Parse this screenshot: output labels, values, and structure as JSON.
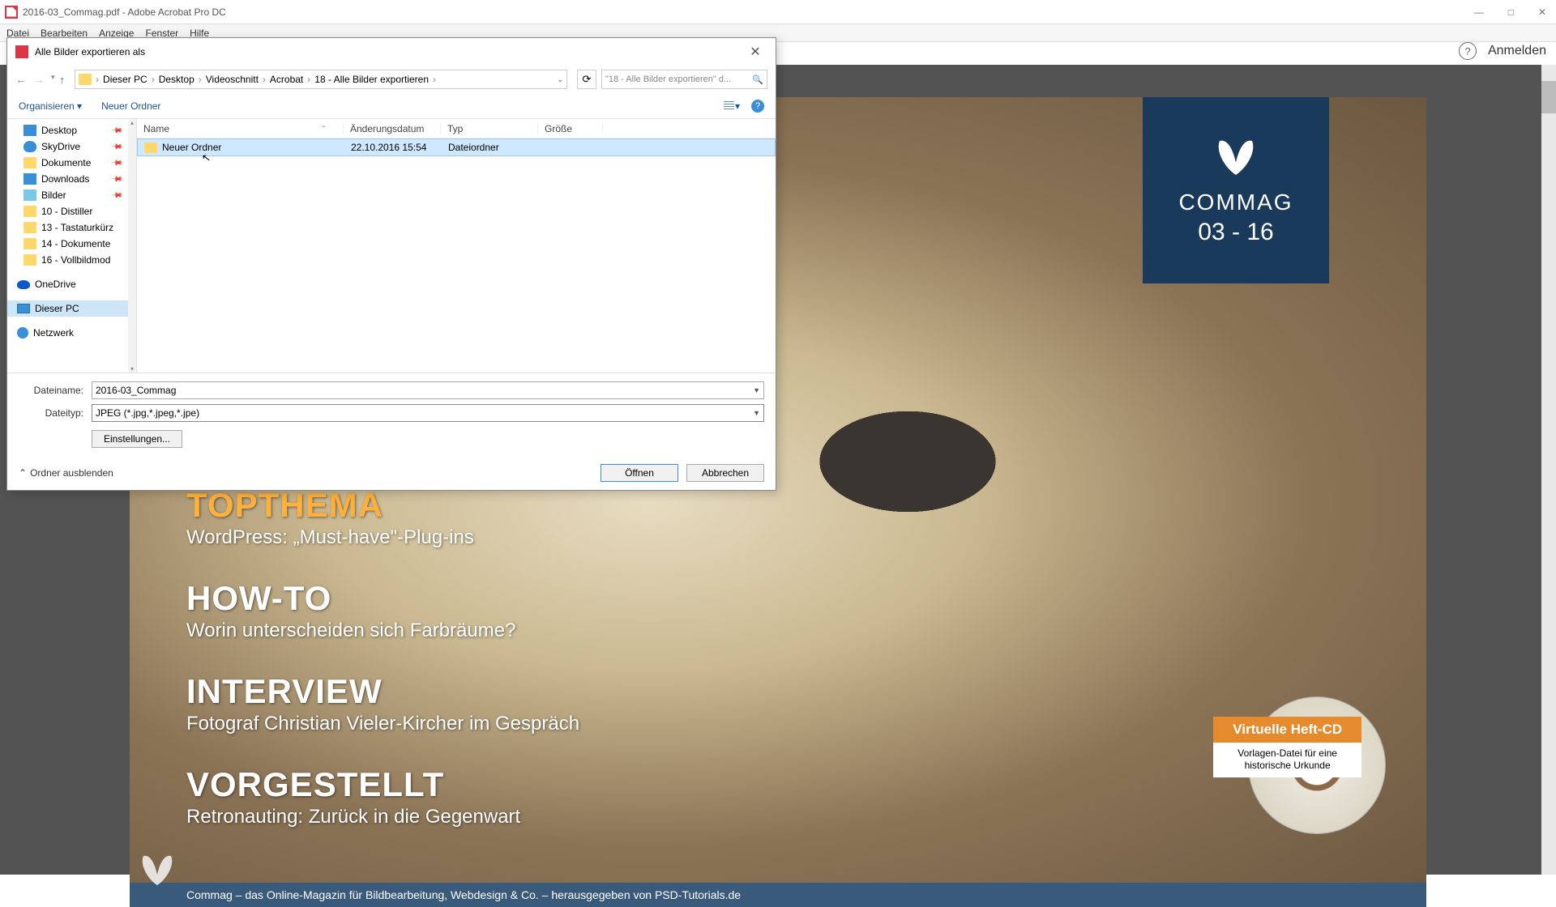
{
  "app": {
    "title": "2016-03_Commag.pdf - Adobe Acrobat Pro DC",
    "menu": [
      "Datei",
      "Bearbeiten",
      "Anzeige",
      "Fenster",
      "Hilfe"
    ],
    "login": "Anmelden"
  },
  "dialog": {
    "title": "Alle Bilder exportieren als",
    "breadcrumb": [
      "Dieser PC",
      "Desktop",
      "Videoschnitt",
      "Acrobat",
      "18 - Alle Bilder exportieren"
    ],
    "search_placeholder": "\"18 - Alle Bilder exportieren\" d...",
    "toolbar": {
      "organize": "Organisieren",
      "new_folder": "Neuer Ordner"
    },
    "sidebar": [
      {
        "label": "Desktop",
        "icon": "desktop",
        "pin": true
      },
      {
        "label": "SkyDrive",
        "icon": "skydrive",
        "pin": true
      },
      {
        "label": "Dokumente",
        "icon": "folder",
        "pin": true
      },
      {
        "label": "Downloads",
        "icon": "download",
        "pin": true
      },
      {
        "label": "Bilder",
        "icon": "img",
        "pin": true
      },
      {
        "label": "10 - Distiller",
        "icon": "folder"
      },
      {
        "label": "13 - Tastaturkürz",
        "icon": "folder"
      },
      {
        "label": "14 - Dokumente",
        "icon": "folder"
      },
      {
        "label": "16 - Vollbildmod",
        "icon": "folder"
      },
      {
        "label": "OneDrive",
        "icon": "onedrive",
        "spacer": true
      },
      {
        "label": "Dieser PC",
        "icon": "pc",
        "selected": true,
        "spacer": true
      },
      {
        "label": "Netzwerk",
        "icon": "network",
        "spacer": true
      }
    ],
    "columns": {
      "name": "Name",
      "date": "Änderungsdatum",
      "type": "Typ",
      "size": "Größe"
    },
    "rows": [
      {
        "name": "Neuer Ordner",
        "date": "22.10.2016 15:54",
        "type": "Dateiordner"
      }
    ],
    "filename_label": "Dateiname:",
    "filename_value": "2016-03_Commag",
    "filetype_label": "Dateityp:",
    "filetype_value": "JPEG (*.jpg,*.jpeg,*.jpe)",
    "settings_btn": "Einstellungen...",
    "hide_folders": "Ordner ausblenden",
    "open_btn": "Öffnen",
    "cancel_btn": "Abbrechen"
  },
  "magazine": {
    "brand": "COMMAG",
    "issue": "03 - 16",
    "sections": [
      {
        "heading": "TOPTHEMA",
        "sub": "WordPress: „Must-have\"-Plug-ins",
        "highlight": true
      },
      {
        "heading": "HOW-TO",
        "sub": "Worin unterscheiden sich Farbräume?"
      },
      {
        "heading": "INTERVIEW",
        "sub": "Fotograf Christian Vieler-Kircher im Gespräch"
      },
      {
        "heading": "VORGESTELLT",
        "sub": "Retronauting: Zurück in die Gegenwart"
      }
    ],
    "cd": {
      "title": "Virtuelle Heft-CD",
      "sub1": "Vorlagen-Datei für eine",
      "sub2": "historische Urkunde"
    },
    "footer": "Commag – das Online-Magazin für Bildbearbeitung, Webdesign & Co. – herausgegeben von PSD-Tutorials.de"
  }
}
